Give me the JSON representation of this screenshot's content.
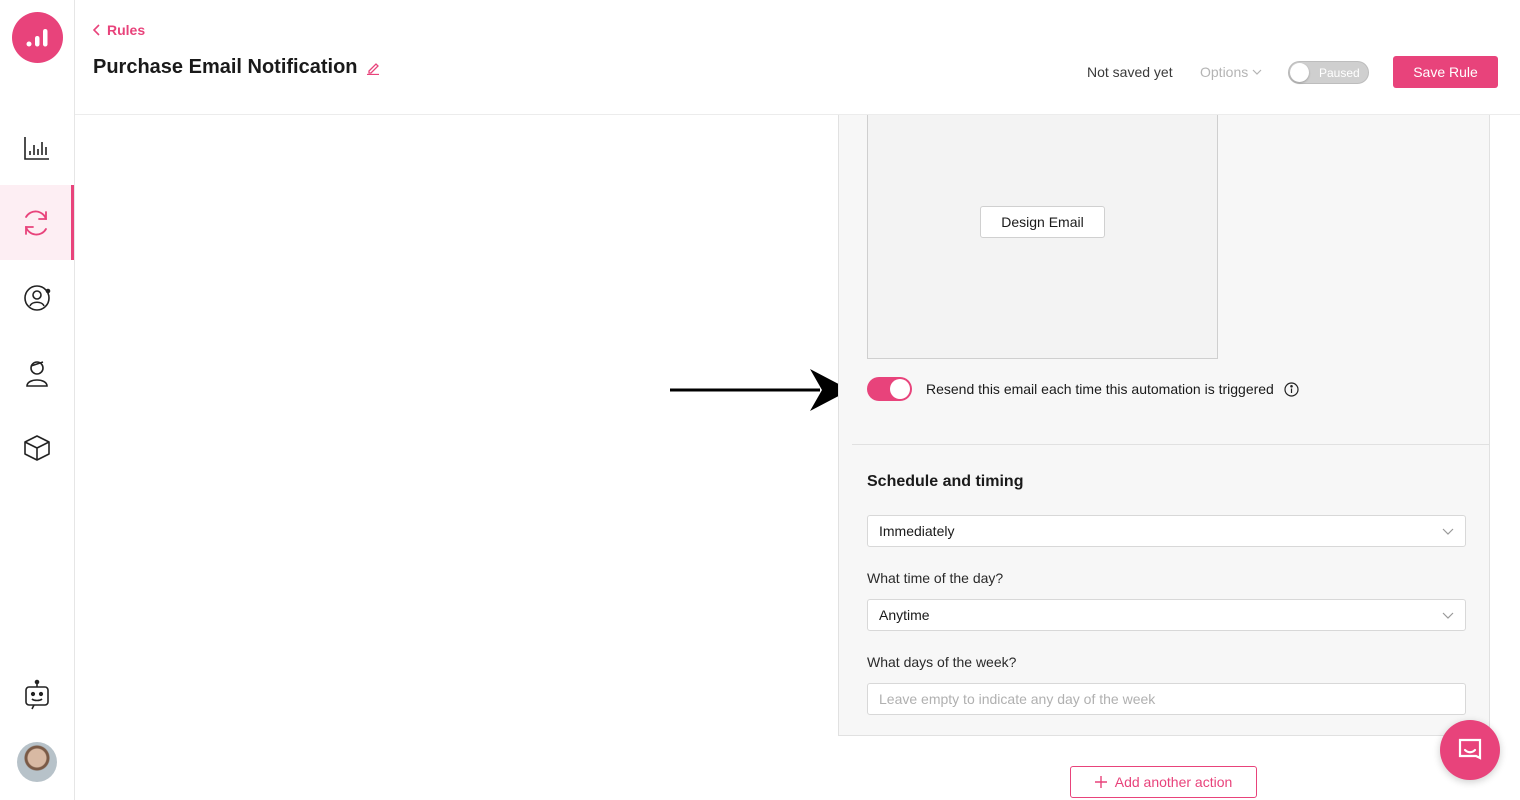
{
  "sidebar": {
    "logo_icon": "bar-chart-logo",
    "items": [
      {
        "icon": "analytics-icon",
        "active": false
      },
      {
        "icon": "automation-sync-icon",
        "active": true
      },
      {
        "icon": "user-circle-icon",
        "active": false
      },
      {
        "icon": "customer-icon",
        "active": false
      },
      {
        "icon": "cube-icon",
        "active": false
      }
    ],
    "bot_icon": "bot-icon",
    "avatar_icon": "user-avatar"
  },
  "header": {
    "back_label": "Rules",
    "title": "Purchase Email Notification",
    "status": "Not saved yet",
    "options_label": "Options",
    "toggle_label": "Paused",
    "save_label": "Save Rule"
  },
  "panel": {
    "design_email_label": "Design Email",
    "resend_label": "Resend this email each time this automation is triggered",
    "resend_enabled": true,
    "schedule_title": "Schedule and timing",
    "schedule_value": "Immediately",
    "time_label": "What time of the day?",
    "time_value": "Anytime",
    "days_label": "What days of the week?",
    "days_placeholder": "Leave empty to indicate any day of the week"
  },
  "add_action_label": "Add another action",
  "colors": {
    "accent": "#e8437b",
    "panel_bg": "#f7f7f7"
  }
}
